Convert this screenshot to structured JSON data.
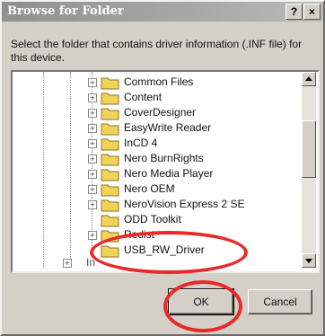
{
  "window": {
    "title": "Browse for Folder",
    "help_label": "?",
    "close_label": "×"
  },
  "description": "Select the folder that contains driver information (.INF file) for this device.",
  "tree": {
    "items": [
      {
        "label": "Common Files",
        "expander": "+"
      },
      {
        "label": "Content",
        "expander": "+"
      },
      {
        "label": "CoverDesigner",
        "expander": "+"
      },
      {
        "label": "EasyWrite Reader",
        "expander": "+"
      },
      {
        "label": "InCD 4",
        "expander": "+"
      },
      {
        "label": "Nero BurnRights",
        "expander": "+"
      },
      {
        "label": "Nero Media Player",
        "expander": "+"
      },
      {
        "label": "Nero OEM",
        "expander": "+"
      },
      {
        "label": "NeroVision Express 2 SE",
        "expander": "+"
      },
      {
        "label": "ODD Toolkit",
        "expander": ""
      },
      {
        "label": "Redist",
        "expander": "+"
      },
      {
        "label": "USB_RW_Driver",
        "expander": ""
      }
    ],
    "partial_bottom_label": "In"
  },
  "buttons": {
    "ok_label": "OK",
    "cancel_label": "Cancel"
  },
  "colors": {
    "annotation_circle": "#e82a2a",
    "folder_yellow": "#f2d35a",
    "title_bar": "#9a9a9a"
  }
}
